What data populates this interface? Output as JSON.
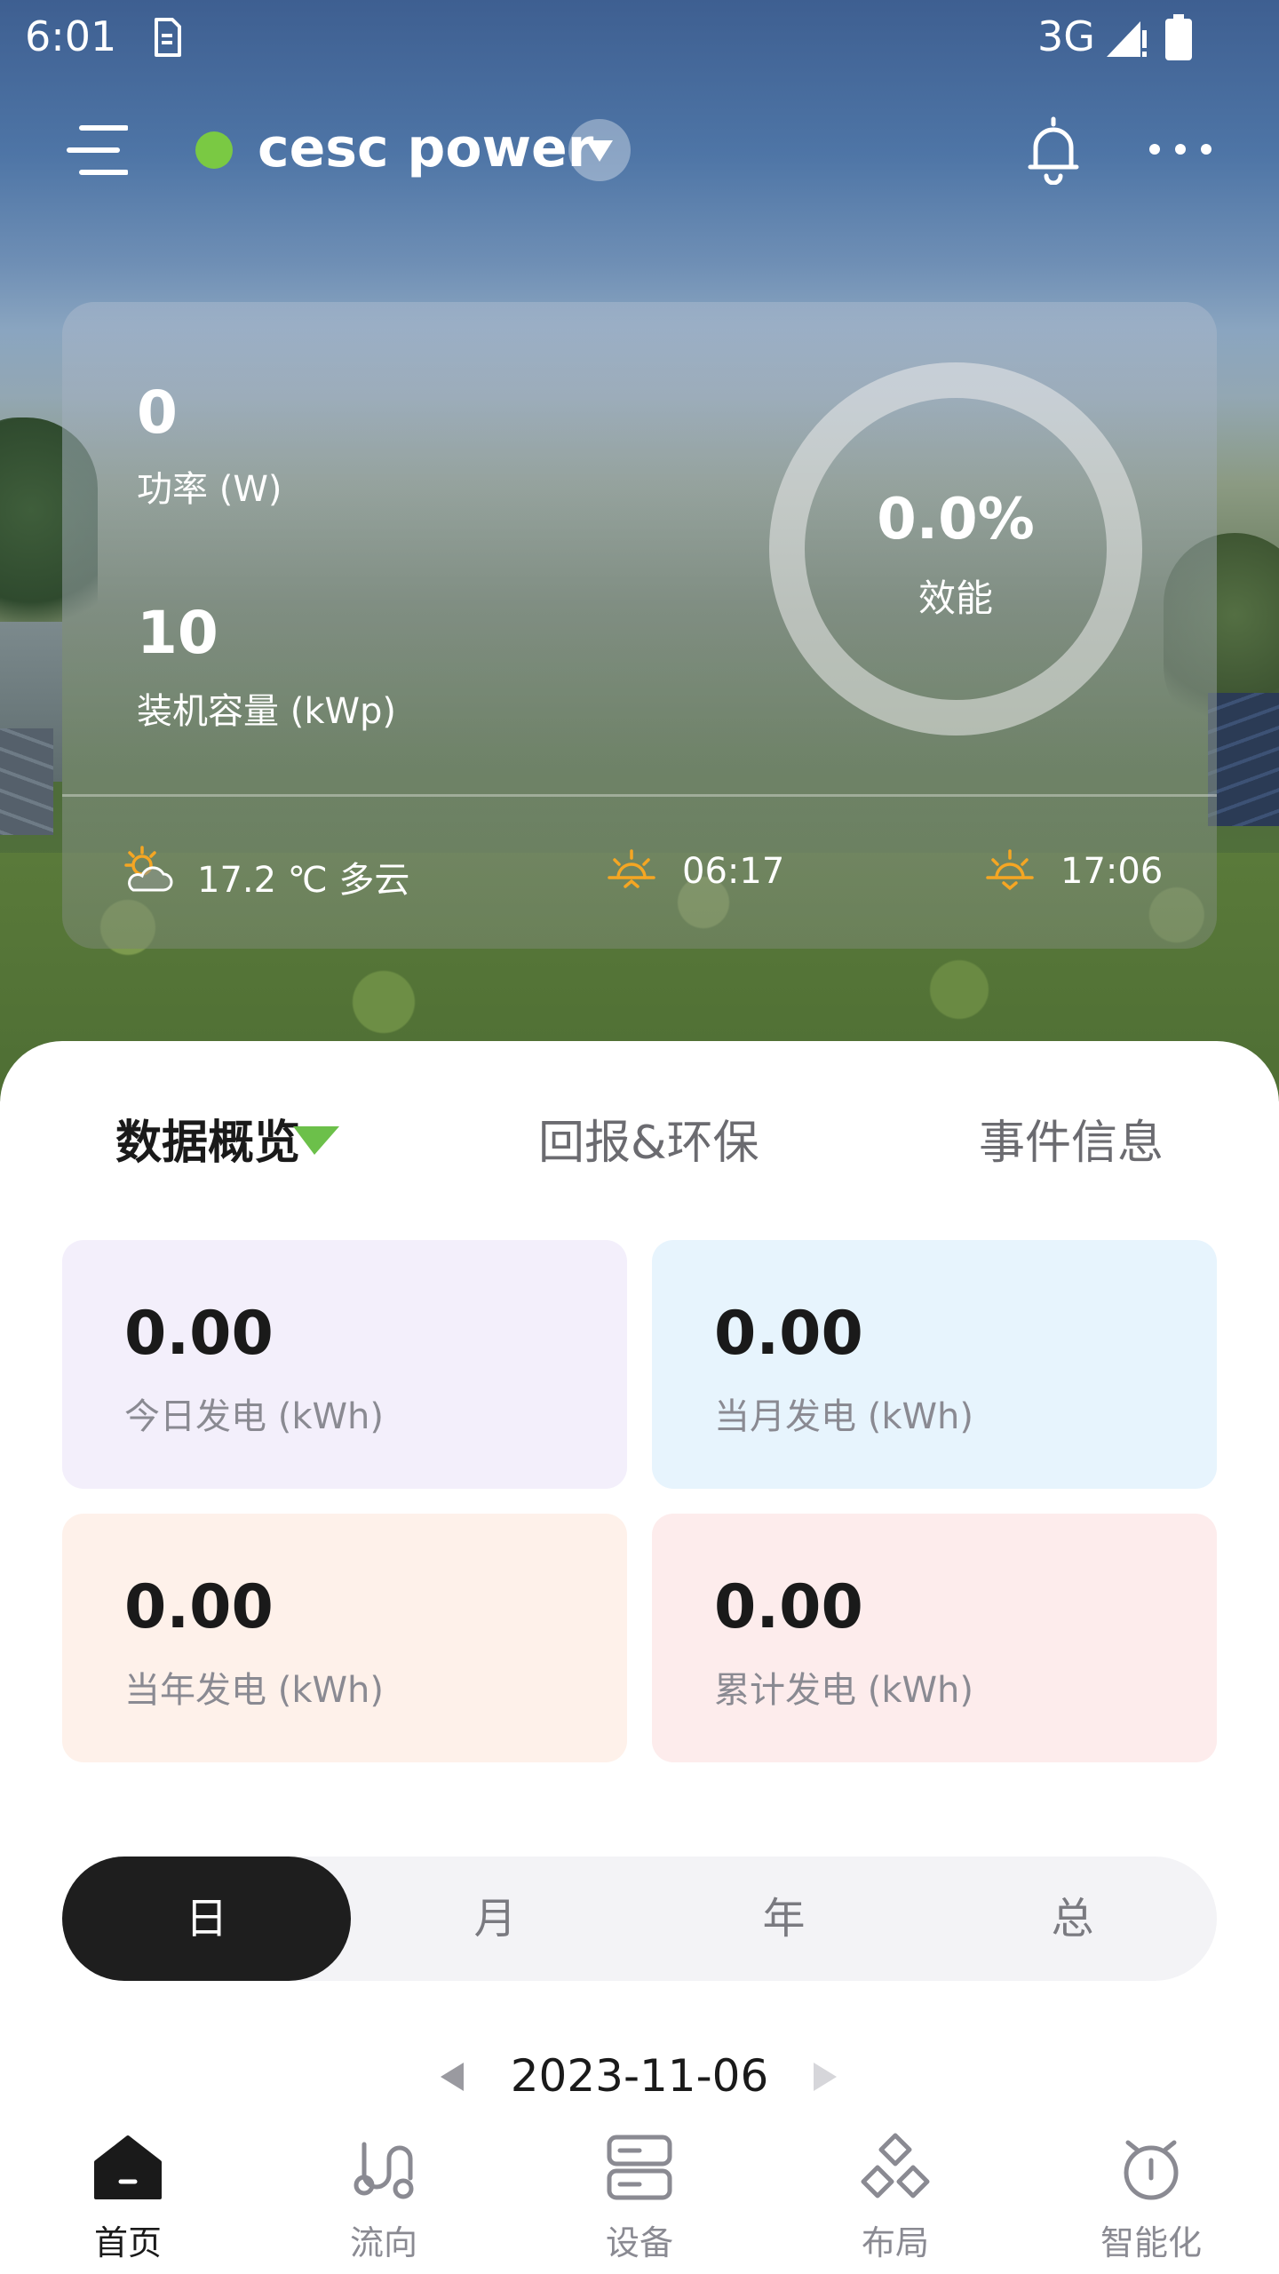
{
  "status_bar": {
    "time": "6:01",
    "network": "3G"
  },
  "header": {
    "plant_name": "cesc power"
  },
  "overview": {
    "power_value": "0",
    "power_label": "功率 (W)",
    "capacity_value": "10",
    "capacity_label": "装机容量 (kWp)",
    "efficiency_value": "0.0%",
    "efficiency_label": "效能",
    "efficiency_fraction": 0.0,
    "weather_text": "17.2 ℃ 多云",
    "sunrise_time": "06:17",
    "sunset_time": "17:06"
  },
  "tabs": [
    {
      "label": "数据概览"
    },
    {
      "label": "回报&环保"
    },
    {
      "label": "事件信息"
    }
  ],
  "stats": {
    "today": {
      "value": "0.00",
      "label": "今日发电 (kWh)"
    },
    "month": {
      "value": "0.00",
      "label": "当月发电 (kWh)"
    },
    "year": {
      "value": "0.00",
      "label": "当年发电 (kWh)"
    },
    "total": {
      "value": "0.00",
      "label": "累计发电 (kWh)"
    }
  },
  "period": {
    "options": [
      "日",
      "月",
      "年",
      "总"
    ],
    "selected": "日"
  },
  "date": "2023-11-06",
  "nav": [
    {
      "label": "首页",
      "icon": "home-icon"
    },
    {
      "label": "流向",
      "icon": "flow-icon"
    },
    {
      "label": "设备",
      "icon": "device-icon"
    },
    {
      "label": "布局",
      "icon": "layout-icon"
    },
    {
      "label": "智能化",
      "icon": "smart-icon"
    }
  ],
  "colors": {
    "online_dot": "#7ac943",
    "accent_green": "#6cc04a",
    "weather_icon": "#f5a623",
    "active_period_bg": "#1e1e1e"
  }
}
